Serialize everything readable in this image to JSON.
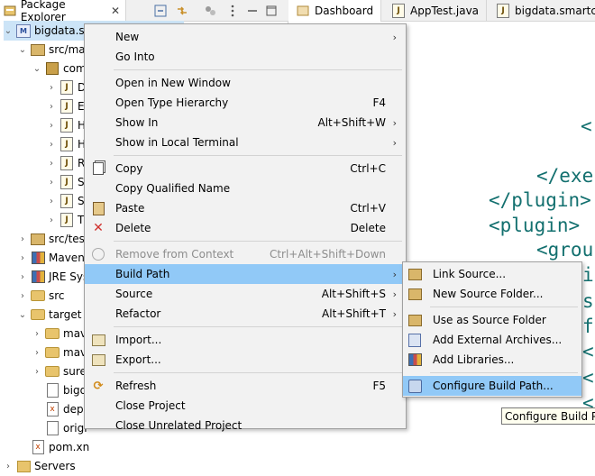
{
  "package_explorer": {
    "tab_label": "Package Explorer",
    "close_glyph": "✕",
    "tree": [
      {
        "label": "bigdata.sm",
        "icon": "project-icon",
        "twisty": "⌄",
        "indent": 0
      },
      {
        "label": "src/mai",
        "icon": "source-folder-icon",
        "twisty": "⌄",
        "indent": 1
      },
      {
        "label": "com",
        "icon": "package-icon",
        "twisty": "⌄",
        "indent": 2
      },
      {
        "label": "D",
        "icon": "java-file-icon",
        "twisty": "›",
        "indent": 3
      },
      {
        "label": "E",
        "icon": "java-file-icon",
        "twisty": "›",
        "indent": 3
      },
      {
        "label": "H",
        "icon": "java-file-icon",
        "twisty": "›",
        "indent": 3
      },
      {
        "label": "H",
        "icon": "java-file-icon",
        "twisty": "›",
        "indent": 3
      },
      {
        "label": "R",
        "icon": "java-file-icon",
        "twisty": "›",
        "indent": 3
      },
      {
        "label": "S",
        "icon": "java-file-icon",
        "twisty": "›",
        "indent": 3
      },
      {
        "label": "S",
        "icon": "java-file-icon",
        "twisty": "›",
        "indent": 3
      },
      {
        "label": "T",
        "icon": "java-file-icon",
        "twisty": "›",
        "indent": 3
      },
      {
        "label": "src/test",
        "icon": "source-folder-icon",
        "twisty": "›",
        "indent": 1
      },
      {
        "label": "Maven",
        "icon": "library-icon",
        "twisty": "›",
        "indent": 1
      },
      {
        "label": "JRE Sys",
        "icon": "library-icon",
        "twisty": "›",
        "indent": 1
      },
      {
        "label": "src",
        "icon": "folder-icon",
        "twisty": "›",
        "indent": 1
      },
      {
        "label": "target",
        "icon": "folder-icon",
        "twisty": "⌄",
        "indent": 1
      },
      {
        "label": "mav",
        "icon": "folder-icon",
        "twisty": "›",
        "indent": 2
      },
      {
        "label": "mav",
        "icon": "folder-icon",
        "twisty": "›",
        "indent": 2
      },
      {
        "label": "sure",
        "icon": "folder-icon",
        "twisty": "›",
        "indent": 2
      },
      {
        "label": "bigd",
        "icon": "file-icon",
        "twisty": "",
        "indent": 2
      },
      {
        "label": "depe",
        "icon": "xml-file-icon",
        "twisty": "",
        "indent": 2
      },
      {
        "label": "origi",
        "icon": "file-icon",
        "twisty": "",
        "indent": 2
      },
      {
        "label": "pom.xn",
        "icon": "xml-file-icon",
        "twisty": "",
        "indent": 1
      },
      {
        "label": "Servers",
        "icon": "server-folder-icon",
        "twisty": "›",
        "indent": 0
      }
    ]
  },
  "editor": {
    "tabs": [
      {
        "label": "Dashboard"
      },
      {
        "label": "AppTest.java"
      },
      {
        "label": "bigdata.smartcar"
      }
    ],
    "code_lines": [
      "</exe",
      "</plugin>",
      "<plugin>",
      "<group",
      "i",
      "s",
      "f",
      "<",
      "<",
      "<"
    ]
  },
  "context_menu": {
    "items": [
      {
        "label": "New",
        "accel": "",
        "submenu": true,
        "icon": "",
        "disabled": false,
        "highlight": false
      },
      {
        "label": "Go Into",
        "accel": "",
        "submenu": false,
        "icon": "",
        "disabled": false,
        "highlight": false
      },
      {
        "sep": true
      },
      {
        "label": "Open in New Window",
        "accel": "",
        "submenu": false,
        "icon": "",
        "disabled": false,
        "highlight": false
      },
      {
        "label": "Open Type Hierarchy",
        "accel": "F4",
        "submenu": false,
        "icon": "",
        "disabled": false,
        "highlight": false
      },
      {
        "label": "Show In",
        "accel": "Alt+Shift+W",
        "submenu": true,
        "icon": "",
        "disabled": false,
        "highlight": false
      },
      {
        "label": "Show in Local Terminal",
        "accel": "",
        "submenu": true,
        "icon": "",
        "disabled": false,
        "highlight": false
      },
      {
        "sep": true
      },
      {
        "label": "Copy",
        "accel": "Ctrl+C",
        "submenu": false,
        "icon": "copy-icon",
        "disabled": false,
        "highlight": false
      },
      {
        "label": "Copy Qualified Name",
        "accel": "",
        "submenu": false,
        "icon": "",
        "disabled": false,
        "highlight": false
      },
      {
        "label": "Paste",
        "accel": "Ctrl+V",
        "submenu": false,
        "icon": "paste-icon",
        "disabled": false,
        "highlight": false
      },
      {
        "label": "Delete",
        "accel": "Delete",
        "submenu": false,
        "icon": "delete-icon",
        "disabled": false,
        "highlight": false
      },
      {
        "sep": true
      },
      {
        "label": "Remove from Context",
        "accel": "Ctrl+Alt+Shift+Down",
        "submenu": false,
        "icon": "remove-context-icon",
        "disabled": true,
        "highlight": false
      },
      {
        "label": "Build Path",
        "accel": "",
        "submenu": true,
        "icon": "",
        "disabled": false,
        "highlight": true
      },
      {
        "label": "Source",
        "accel": "Alt+Shift+S",
        "submenu": true,
        "icon": "",
        "disabled": false,
        "highlight": false
      },
      {
        "label": "Refactor",
        "accel": "Alt+Shift+T",
        "submenu": true,
        "icon": "",
        "disabled": false,
        "highlight": false
      },
      {
        "sep": true
      },
      {
        "label": "Import...",
        "accel": "",
        "submenu": false,
        "icon": "import-icon",
        "disabled": false,
        "highlight": false
      },
      {
        "label": "Export...",
        "accel": "",
        "submenu": false,
        "icon": "export-icon",
        "disabled": false,
        "highlight": false
      },
      {
        "sep": true
      },
      {
        "label": "Refresh",
        "accel": "F5",
        "submenu": false,
        "icon": "refresh-icon",
        "disabled": false,
        "highlight": false
      },
      {
        "label": "Close Project",
        "accel": "",
        "submenu": false,
        "icon": "",
        "disabled": false,
        "highlight": false
      },
      {
        "label": "Close Unrelated Project",
        "accel": "",
        "submenu": false,
        "icon": "",
        "disabled": false,
        "highlight": false
      }
    ]
  },
  "build_path_submenu": {
    "items": [
      {
        "label": "Link Source...",
        "icon": "link-source-icon",
        "highlight": false
      },
      {
        "label": "New Source Folder...",
        "icon": "new-source-folder-icon",
        "highlight": false
      },
      {
        "sep": true
      },
      {
        "label": "Use as Source Folder",
        "icon": "use-source-folder-icon",
        "highlight": false
      },
      {
        "label": "Add External Archives...",
        "icon": "external-archive-icon",
        "highlight": false
      },
      {
        "label": "Add Libraries...",
        "icon": "libraries-icon",
        "highlight": false
      },
      {
        "sep": true
      },
      {
        "label": "Configure Build Path...",
        "icon": "configure-build-path-icon",
        "highlight": true
      }
    ]
  },
  "tooltip": {
    "text": "Configure Build Pa"
  },
  "colors": {
    "menu_highlight": "#91c9f7",
    "code_text": "#13706f",
    "selection": "#cce4f7"
  }
}
